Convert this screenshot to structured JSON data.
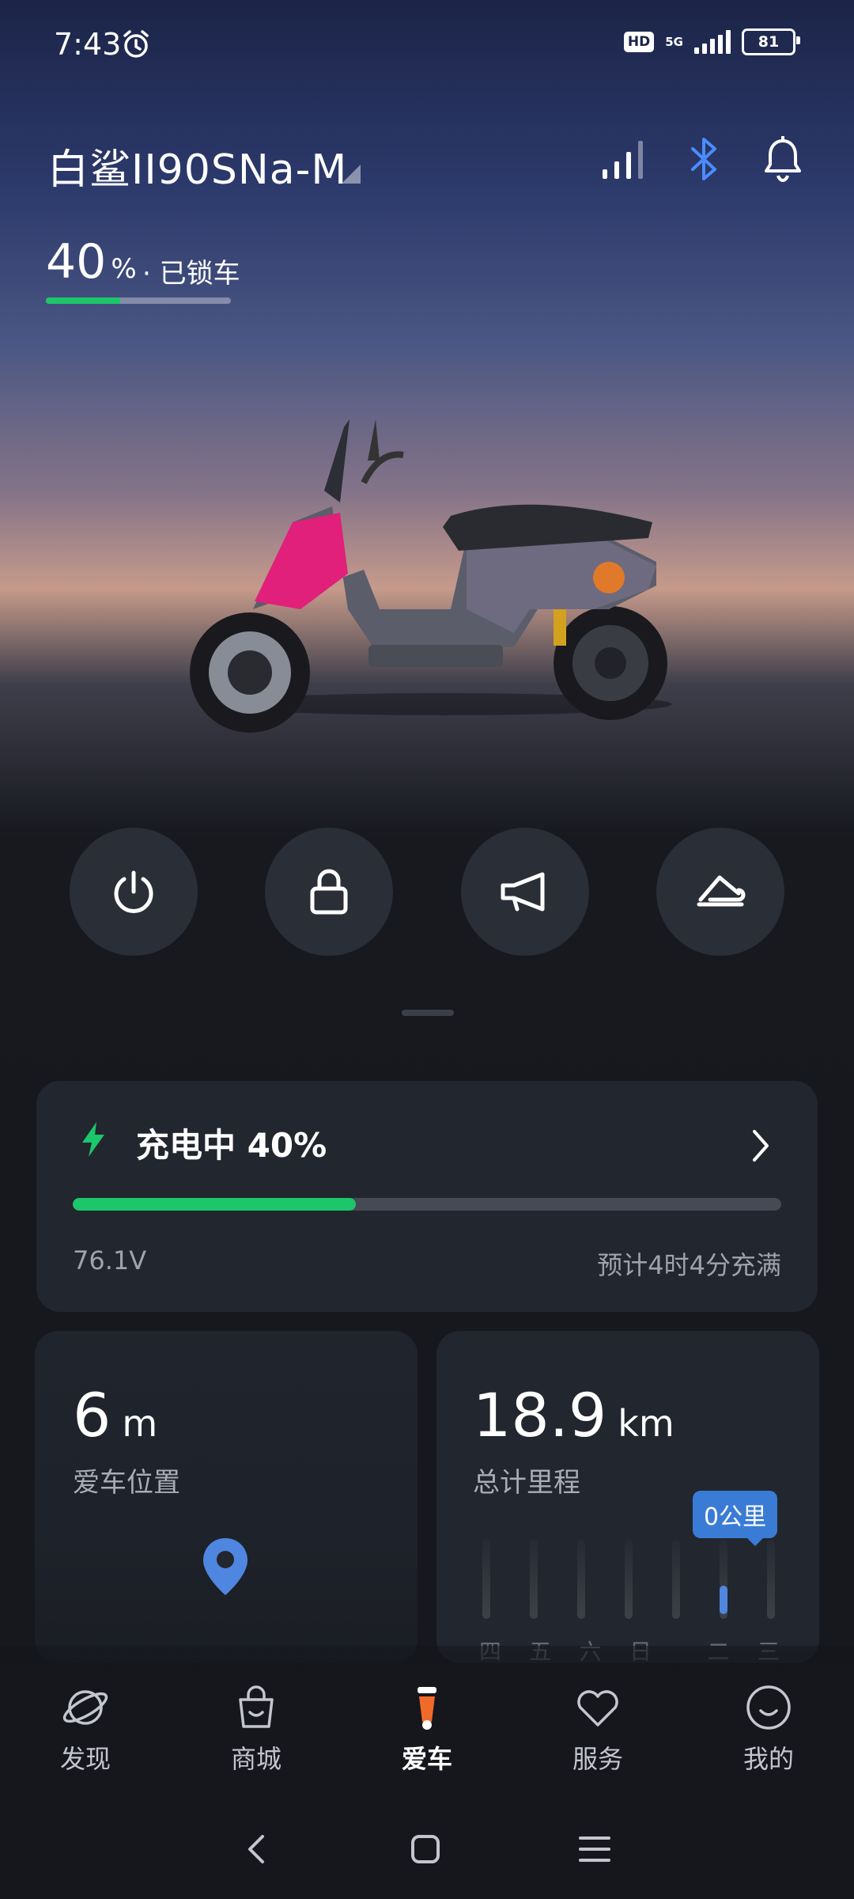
{
  "status_bar": {
    "time": "7:43",
    "network_label": "HD",
    "network_type": "5G",
    "battery_level": "81"
  },
  "header": {
    "vehicle_name": "白鲨II90SNa-M",
    "battery_percent": "40",
    "percent_unit": "%",
    "lock_status": "· 已锁车",
    "battery_fill_fraction": 0.4,
    "icons": [
      "signal-icon",
      "bluetooth-icon",
      "bell-icon"
    ]
  },
  "actions": [
    {
      "name": "power-button",
      "icon": "power-icon"
    },
    {
      "name": "lock-button",
      "icon": "lock-icon"
    },
    {
      "name": "horn-button",
      "icon": "horn-icon"
    },
    {
      "name": "seat-button",
      "icon": "seat-icon"
    }
  ],
  "charging": {
    "title": "充电中 40%",
    "progress_fraction": 0.4,
    "voltage": "76.1V",
    "eta": "预计4时4分充满",
    "accent_color": "#1cc66a"
  },
  "location_card": {
    "value": "6",
    "unit": "m",
    "label": "爱车位置"
  },
  "mileage_card": {
    "value": "18.9",
    "unit": "km",
    "label": "总计里程",
    "tooltip": "0公里",
    "days": [
      "四",
      "五",
      "六",
      "日",
      "",
      "二",
      "三"
    ]
  },
  "bottom_nav": [
    {
      "label": "发现",
      "icon": "planet-icon",
      "active": false
    },
    {
      "label": "商城",
      "icon": "bag-icon",
      "active": false
    },
    {
      "label": "爱车",
      "icon": "scooter-icon",
      "active": true
    },
    {
      "label": "服务",
      "icon": "heart-icon",
      "active": false
    },
    {
      "label": "我的",
      "icon": "smile-icon",
      "active": false
    }
  ],
  "colors": {
    "accent_green": "#1cc66a",
    "accent_blue": "#3a7bd5",
    "bluetooth_blue": "#4a8cff"
  }
}
